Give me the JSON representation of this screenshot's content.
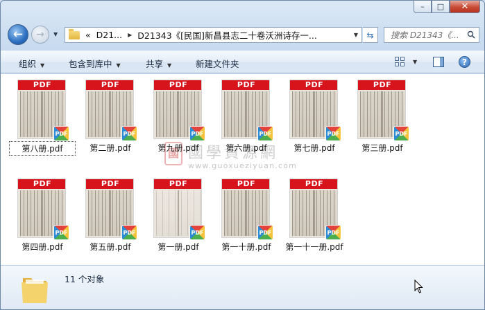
{
  "window": {
    "caption_buttons": {
      "minimize": "–",
      "maximize": "□",
      "close": "✕"
    }
  },
  "nav": {
    "back_icon": "arrow-left-icon",
    "forward_icon": "arrow-right-icon",
    "breadcrumb": {
      "overflow": "«",
      "parent": "D21...",
      "current": "D21343《[民国]新昌县志二十卷沃洲诗存一..."
    },
    "search": {
      "placeholder": "搜索 D21343《..."
    }
  },
  "toolbar": {
    "organize": "组织",
    "include_in_library": "包含到库中",
    "share": "共享",
    "new_folder": "新建文件夹",
    "help": "?"
  },
  "files": [
    {
      "name": "第八册.pdf",
      "band": "PDF",
      "badge": "PDF",
      "selected": true
    },
    {
      "name": "第二册.pdf",
      "band": "PDF",
      "badge": "PDF"
    },
    {
      "name": "第九册.pdf",
      "band": "PDF",
      "badge": "PDF"
    },
    {
      "name": "第六册.pdf",
      "band": "PDF",
      "badge": "PDF"
    },
    {
      "name": "第七册.pdf",
      "band": "PDF",
      "badge": "PDF"
    },
    {
      "name": "第三册.pdf",
      "band": "PDF",
      "badge": "PDF"
    },
    {
      "name": "第四册.pdf",
      "band": "PDF",
      "badge": "PDF"
    },
    {
      "name": "第五册.pdf",
      "band": "PDF",
      "badge": "PDF"
    },
    {
      "name": "第一册.pdf",
      "band": "PDF",
      "badge": "PDF"
    },
    {
      "name": "第一十册.pdf",
      "band": "PDF",
      "badge": "PDF"
    },
    {
      "name": "第一十一册.pdf",
      "band": "PDF",
      "badge": "PDF"
    }
  ],
  "watermark": {
    "seal": "國",
    "title": "國學資源網",
    "url": "www.guoxueziyuan.com"
  },
  "status": {
    "count": "11 个对象"
  },
  "colors": {
    "pdf_band": "#d7141c",
    "toolbar": "#dde8f5",
    "selection_border": "#555555"
  }
}
